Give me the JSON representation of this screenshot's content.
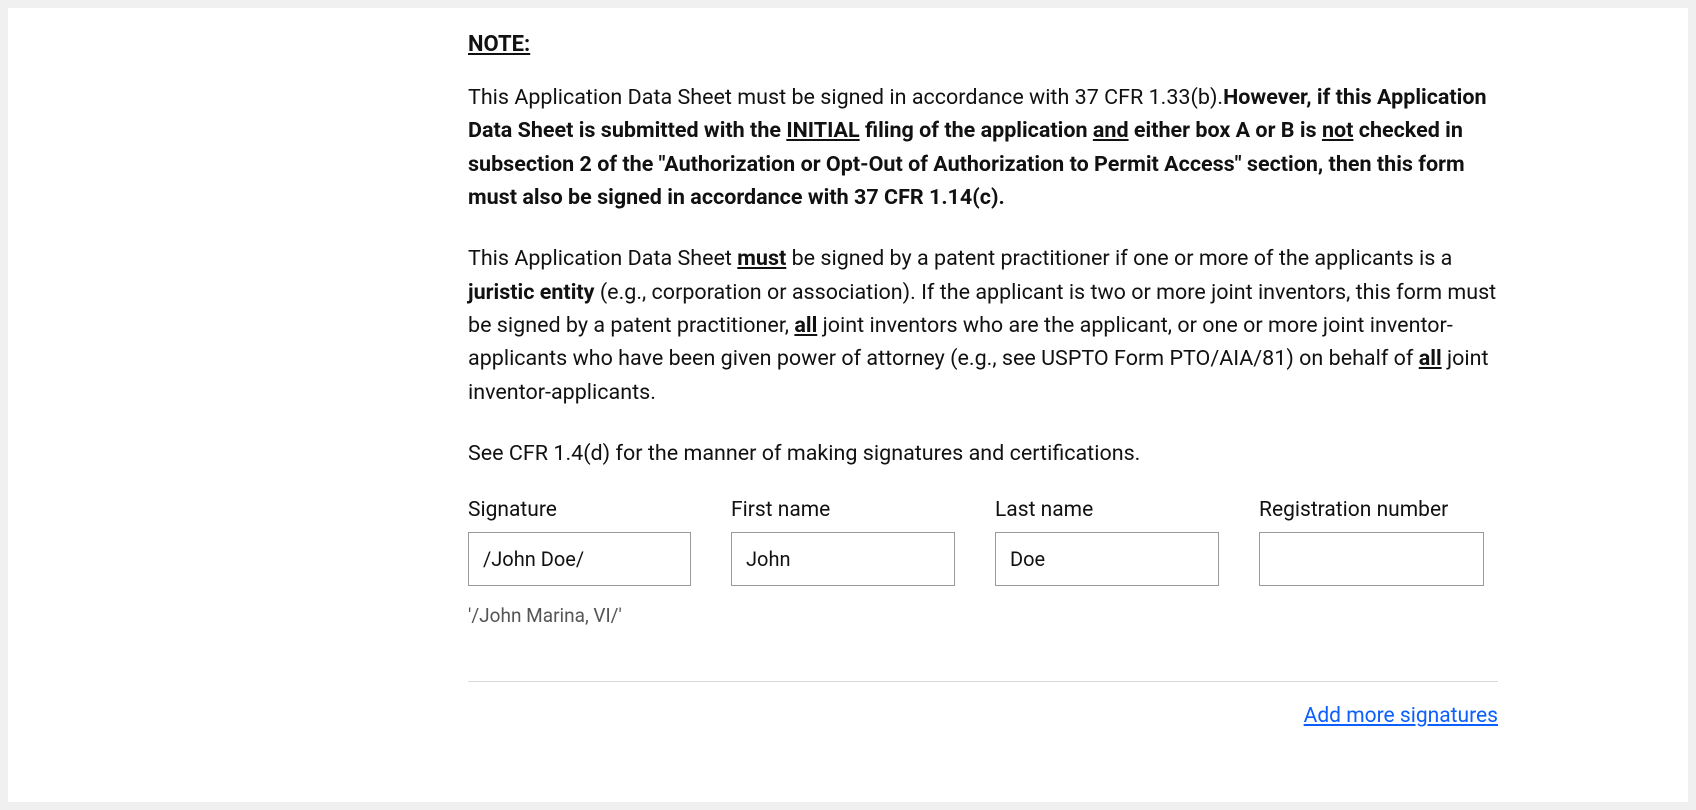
{
  "note": {
    "heading": "NOTE:",
    "p1_pre": "This Application Data Sheet must be signed in accordance with 37 CFR 1.33(b).",
    "p1_a": "However, if this Application Data Sheet is submitted with the ",
    "p1_initial": "INITIAL",
    "p1_b": " filing of the application  ",
    "p1_and": "and",
    "p1_c": " either box A or B is ",
    "p1_not": "not",
    "p1_d": " checked in subsection 2 of the \"Authorization or Opt-Out of Authorization to Permit Access\" section, then this form must also be signed in accordance with 37 CFR 1.14(c).",
    "p2_a": "This Application Data Sheet ",
    "p2_must": "must",
    "p2_b": " be signed by a patent practitioner if one or more of the applicants is a ",
    "p2_juristic": "juristic entity",
    "p2_c": " (e.g., corporation or association). If the applicant is two or more joint inventors, this form must be signed by a patent practitioner, ",
    "p2_all1": "all",
    "p2_d": " joint inventors who are the applicant, or one or more joint inventor-applicants who have been given power of attorney (e.g., see USPTO Form PTO/AIA/81) on behalf of ",
    "p2_all2": "all",
    "p2_e": " joint inventor-applicants.",
    "p3": "See CFR 1.4(d) for the manner of making signatures and certifications."
  },
  "form": {
    "signature": {
      "label": "Signature",
      "value": "/John Doe/",
      "hint": "'/John Marina, VI/'"
    },
    "first_name": {
      "label": "First name",
      "value": "John"
    },
    "last_name": {
      "label": "Last name",
      "value": "Doe"
    },
    "registration_number": {
      "label": "Registration number",
      "value": ""
    }
  },
  "actions": {
    "add_more": "Add more signatures"
  }
}
